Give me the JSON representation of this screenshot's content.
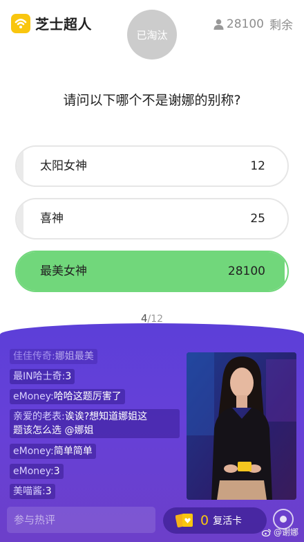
{
  "header": {
    "logo_text": "芝士超人",
    "logo_icon": "wifi-badge-icon",
    "status_badge": "已淘汰",
    "remaining_count": "28100",
    "remaining_label": "剩余"
  },
  "question": "请问以下哪个不是谢娜的别称?",
  "options": [
    {
      "label": "太阳女神",
      "votes": "12",
      "share": 0.0004,
      "correct": false
    },
    {
      "label": "喜神",
      "votes": "25",
      "share": 0.0009,
      "correct": false
    },
    {
      "label": "最美女神",
      "votes": "28100",
      "share": 0.99,
      "correct": true
    }
  ],
  "progress": {
    "current": "4",
    "total": "/12"
  },
  "comments": [
    {
      "user": "佳佳传奇:",
      "text": "娜姐最美",
      "faded": true
    },
    {
      "user": "最IN哈士奇:",
      "text": "3"
    },
    {
      "user": "eMoney:",
      "text": "哈哈这题厉害了"
    },
    {
      "user": "亲爱的老表:",
      "text": "诶诶?想知道娜姐这"
    },
    {
      "user": "",
      "text": "题该怎么选 @娜姐"
    },
    {
      "user": "eMoney:",
      "text": "简单简单"
    },
    {
      "user": "eMoney:",
      "text": "3"
    },
    {
      "user": "美喵酱:",
      "text": "3"
    }
  ],
  "input_placeholder": "参与热评",
  "revive": {
    "count": "0",
    "label": "复活卡"
  },
  "watermark": "@谢娜",
  "colors": {
    "accent_yellow": "#f9c60f",
    "correct_green": "#71d77b",
    "live_purple": "#6640d8"
  }
}
